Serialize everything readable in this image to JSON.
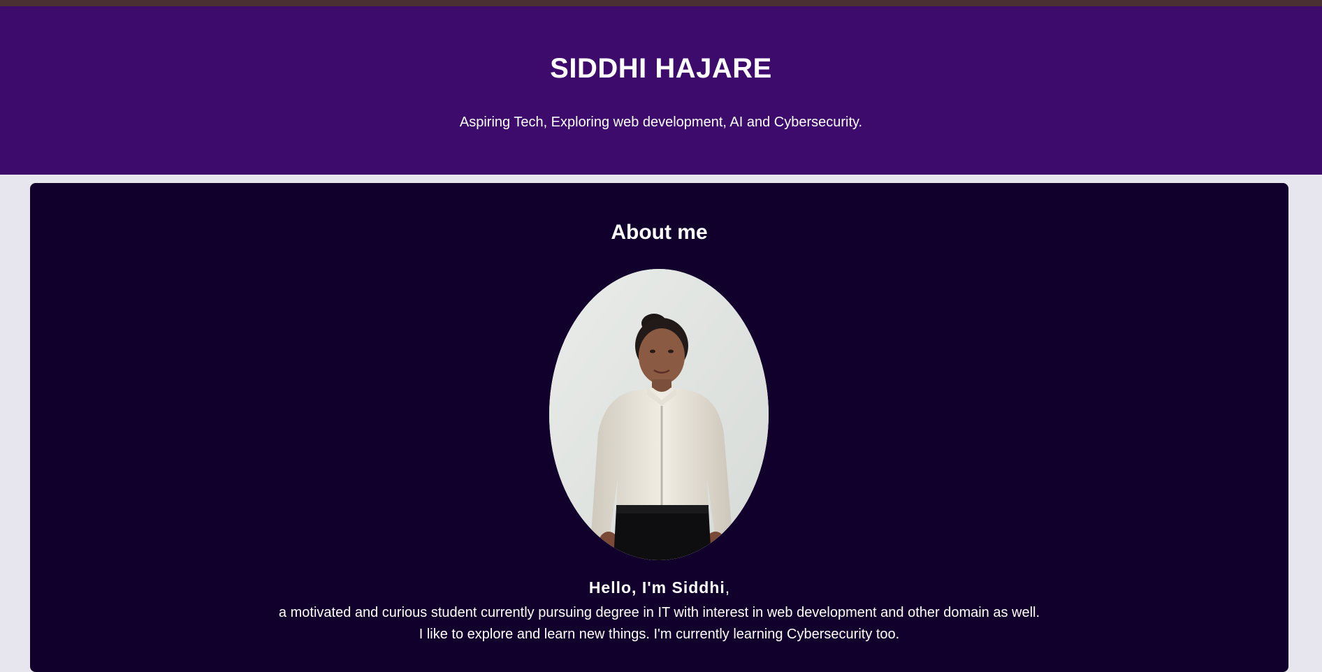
{
  "header": {
    "name": "SIDDHI HAJARE",
    "tagline": "Aspiring Tech, Exploring web development, AI and Cybersecurity."
  },
  "about": {
    "heading": "About me",
    "greeting_strong": "Hello, I'm Siddhi",
    "greeting_suffix": ",",
    "bio_line_1": "a motivated and curious student currently pursuing degree in IT with interest in web development and other domain as well.",
    "bio_line_2": "I like to explore and learn new things. I'm currently learning Cybersecurity too."
  },
  "colors": {
    "top_strip": "#4b3033",
    "header_bg": "#3c0b6b",
    "page_bg": "#e7e6ee",
    "card_bg": "#12002c",
    "text": "#ffffff"
  }
}
